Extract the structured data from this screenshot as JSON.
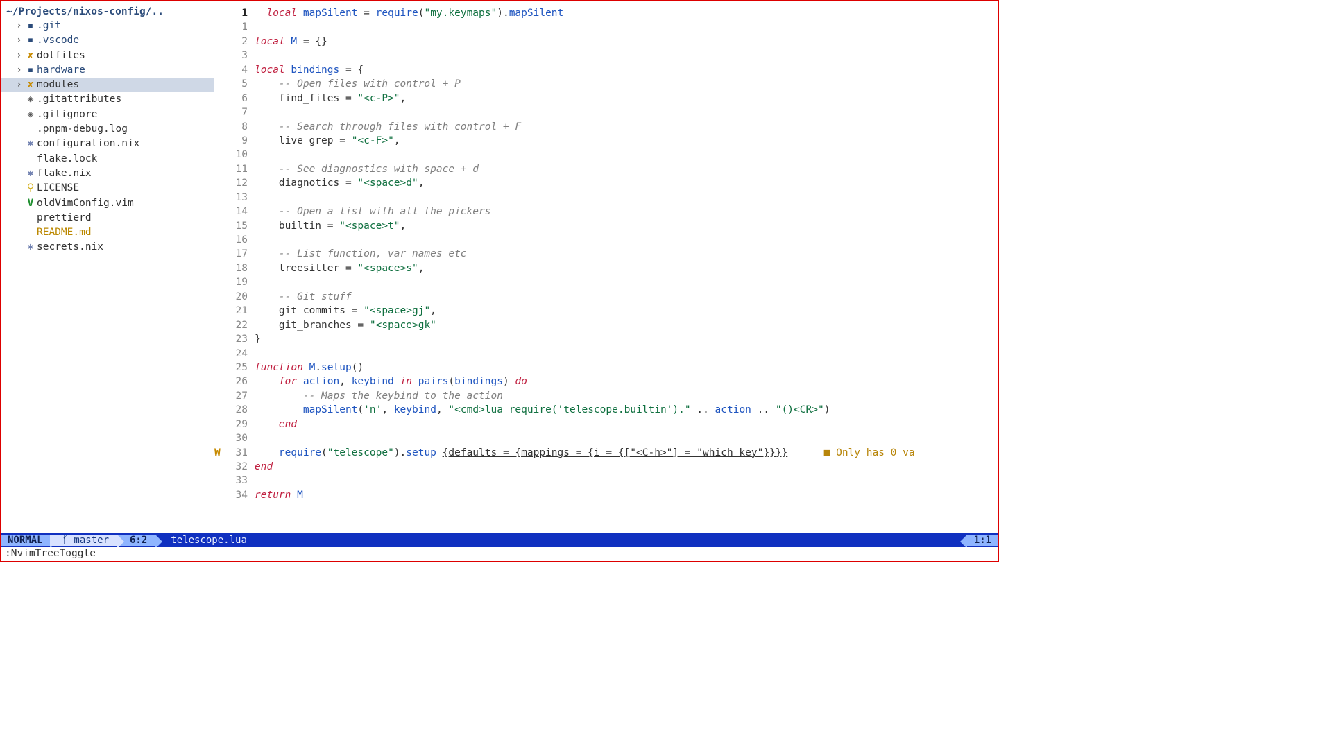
{
  "tree": {
    "root": "~/Projects/nixos-config/..",
    "items": [
      {
        "kind": "folder",
        "icon": "▪",
        "name": ".git",
        "chev": "›"
      },
      {
        "kind": "folder",
        "icon": "▪",
        "name": ".vscode",
        "chev": "›"
      },
      {
        "kind": "exec",
        "icon": "x",
        "name": "dotfiles",
        "chev": "›"
      },
      {
        "kind": "folder",
        "icon": "▪",
        "name": "hardware",
        "chev": "›"
      },
      {
        "kind": "exec",
        "icon": "x",
        "name": "modules",
        "chev": "›",
        "selected": true
      },
      {
        "kind": "git",
        "icon": "◈",
        "name": ".gitattributes"
      },
      {
        "kind": "git",
        "icon": "◈",
        "name": ".gitignore"
      },
      {
        "kind": "file",
        "icon": "",
        "name": ".pnpm-debug.log"
      },
      {
        "kind": "nix",
        "icon": "✱",
        "name": "configuration.nix"
      },
      {
        "kind": "file",
        "icon": "",
        "name": "flake.lock"
      },
      {
        "kind": "nix",
        "icon": "✱",
        "name": "flake.nix"
      },
      {
        "kind": "key",
        "icon": "⚲",
        "name": "LICENSE"
      },
      {
        "kind": "vim",
        "icon": "V",
        "name": "oldVimConfig.vim"
      },
      {
        "kind": "file",
        "icon": "",
        "name": "prettierd"
      },
      {
        "kind": "highlight",
        "icon": "",
        "name": "README.md"
      },
      {
        "kind": "nix",
        "icon": "✱",
        "name": "secrets.nix"
      }
    ]
  },
  "code": {
    "lines": [
      {
        "n": 1,
        "cur": true,
        "segs": [
          [
            "kw",
            "  local "
          ],
          [
            "id",
            "mapSilent"
          ],
          [
            "punc",
            " = "
          ],
          [
            "fn",
            "require"
          ],
          [
            "punc",
            "("
          ],
          [
            "str",
            "\"my.keymaps\""
          ],
          [
            "punc",
            ")."
          ],
          [
            "id",
            "mapSilent"
          ]
        ]
      },
      {
        "n": 1,
        "segs": []
      },
      {
        "n": 2,
        "segs": [
          [
            "kw",
            "local "
          ],
          [
            "id",
            "M"
          ],
          [
            "punc",
            " = {}"
          ]
        ]
      },
      {
        "n": 3,
        "segs": []
      },
      {
        "n": 4,
        "segs": [
          [
            "kw",
            "local "
          ],
          [
            "id",
            "bindings"
          ],
          [
            "punc",
            " = {"
          ]
        ]
      },
      {
        "n": 5,
        "segs": [
          [
            "cmt",
            "    -- Open files with control + P"
          ]
        ]
      },
      {
        "n": 6,
        "segs": [
          [
            "punc",
            "    find_files = "
          ],
          [
            "str",
            "\"<c-P>\""
          ],
          [
            "punc",
            ","
          ]
        ]
      },
      {
        "n": 7,
        "segs": []
      },
      {
        "n": 8,
        "segs": [
          [
            "cmt",
            "    -- Search through files with control + F"
          ]
        ]
      },
      {
        "n": 9,
        "segs": [
          [
            "punc",
            "    live_grep = "
          ],
          [
            "str",
            "\"<c-F>\""
          ],
          [
            "punc",
            ","
          ]
        ]
      },
      {
        "n": 10,
        "segs": []
      },
      {
        "n": 11,
        "segs": [
          [
            "cmt",
            "    -- See diagnostics with space + d"
          ]
        ]
      },
      {
        "n": 12,
        "segs": [
          [
            "punc",
            "    diagnotics = "
          ],
          [
            "str",
            "\"<space>d\""
          ],
          [
            "punc",
            ","
          ]
        ]
      },
      {
        "n": 13,
        "segs": []
      },
      {
        "n": 14,
        "segs": [
          [
            "cmt",
            "    -- Open a list with all the pickers"
          ]
        ]
      },
      {
        "n": 15,
        "segs": [
          [
            "punc",
            "    builtin = "
          ],
          [
            "str",
            "\"<space>t\""
          ],
          [
            "punc",
            ","
          ]
        ]
      },
      {
        "n": 16,
        "segs": []
      },
      {
        "n": 17,
        "segs": [
          [
            "cmt",
            "    -- List function, var names etc"
          ]
        ]
      },
      {
        "n": 18,
        "segs": [
          [
            "punc",
            "    treesitter = "
          ],
          [
            "str",
            "\"<space>s\""
          ],
          [
            "punc",
            ","
          ]
        ]
      },
      {
        "n": 19,
        "segs": []
      },
      {
        "n": 20,
        "segs": [
          [
            "cmt",
            "    -- Git stuff"
          ]
        ]
      },
      {
        "n": 21,
        "segs": [
          [
            "punc",
            "    git_commits = "
          ],
          [
            "str",
            "\"<space>gj\""
          ],
          [
            "punc",
            ","
          ]
        ]
      },
      {
        "n": 22,
        "segs": [
          [
            "punc",
            "    git_branches = "
          ],
          [
            "str",
            "\"<space>gk\""
          ]
        ]
      },
      {
        "n": 23,
        "segs": [
          [
            "punc",
            "}"
          ]
        ]
      },
      {
        "n": 24,
        "segs": []
      },
      {
        "n": 25,
        "segs": [
          [
            "kw",
            "function "
          ],
          [
            "id",
            "M"
          ],
          [
            "punc",
            "."
          ],
          [
            "fn",
            "setup"
          ],
          [
            "punc",
            "()"
          ]
        ]
      },
      {
        "n": 26,
        "segs": [
          [
            "punc",
            "    "
          ],
          [
            "kw",
            "for "
          ],
          [
            "id",
            "action"
          ],
          [
            "punc",
            ", "
          ],
          [
            "id",
            "keybind"
          ],
          [
            "kw",
            " in "
          ],
          [
            "fn",
            "pairs"
          ],
          [
            "punc",
            "("
          ],
          [
            "id",
            "bindings"
          ],
          [
            "punc",
            ") "
          ],
          [
            "kw",
            "do"
          ]
        ]
      },
      {
        "n": 27,
        "segs": [
          [
            "cmt",
            "        -- Maps the keybind to the action"
          ]
        ]
      },
      {
        "n": 28,
        "segs": [
          [
            "punc",
            "        "
          ],
          [
            "fn",
            "mapSilent"
          ],
          [
            "punc",
            "("
          ],
          [
            "str",
            "'n'"
          ],
          [
            "punc",
            ", "
          ],
          [
            "id",
            "keybind"
          ],
          [
            "punc",
            ", "
          ],
          [
            "str",
            "\"<cmd>lua require('telescope.builtin').\""
          ],
          [
            "punc",
            " .. "
          ],
          [
            "id",
            "action"
          ],
          [
            "punc",
            " .. "
          ],
          [
            "str",
            "\"()<CR>\""
          ],
          [
            "punc",
            ")"
          ]
        ]
      },
      {
        "n": 29,
        "segs": [
          [
            "punc",
            "    "
          ],
          [
            "kw",
            "end"
          ]
        ]
      },
      {
        "n": 30,
        "segs": []
      },
      {
        "n": 31,
        "diag": "W",
        "segs": [
          [
            "punc",
            "    "
          ],
          [
            "fn",
            "require"
          ],
          [
            "punc",
            "("
          ],
          [
            "str",
            "\"telescope\""
          ],
          [
            "punc",
            ")."
          ],
          [
            "fn",
            "setup"
          ],
          [
            "punc",
            " "
          ],
          [
            "ul",
            "{defaults = {mappings = {i = {[\"<C-h>\"] = \"which_key\"}}}}"
          ]
        ],
        "inline": "■ Only has 0 va"
      },
      {
        "n": 32,
        "segs": [
          [
            "kw",
            "end"
          ]
        ]
      },
      {
        "n": 33,
        "segs": []
      },
      {
        "n": 34,
        "segs": [
          [
            "kw",
            "return "
          ],
          [
            "id",
            "M"
          ]
        ]
      }
    ]
  },
  "status": {
    "mode": "NORMAL",
    "branch_icon": "ᚶ",
    "branch": "master",
    "pos": "6:2",
    "file": "telescope.lua",
    "right": "1:1"
  },
  "cmdline": ":NvimTreeToggle"
}
